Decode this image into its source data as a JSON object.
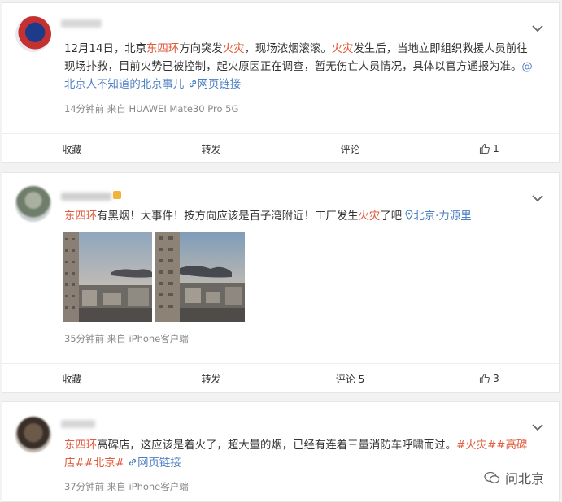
{
  "posts": [
    {
      "content": {
        "p1": "12月14日，北京",
        "k1": "东四环",
        "p2": "方向突发",
        "k2": "火灾",
        "p3": "，现场浓烟滚滚。",
        "k3": "火灾",
        "p4": "发生后，当地立即组织救援人员前往现场扑救，目前火势已被控制，起火原因正在调查，暂无伤亡人员情况，具体以官方通报为准。",
        "mention": "@北京人不知道的北京事儿",
        "weblink": "网页链接"
      },
      "meta": "14分钟前  来自 HUAWEI Mate30 Pro 5G",
      "actions": {
        "fav": "收藏",
        "repost": "转发",
        "comment": "评论",
        "like": "1"
      }
    },
    {
      "content": {
        "k1": "东四环",
        "p1": "有黑烟！大事件！按方向应该是百子湾附近！工厂发生",
        "k2": "火灾",
        "p2": "了吧",
        "location": "北京·力源里"
      },
      "meta": "35分钟前  来自 iPhone客户端",
      "actions": {
        "fav": "收藏",
        "repost": "转发",
        "comment": "评论 5",
        "like": "3"
      }
    },
    {
      "content": {
        "k1": "东四环",
        "p1": "高碑店，这应该是着火了，超大量的烟，已经有连着三量消防车呼啸而过。",
        "tags": "#火灾##高碑店##北京#",
        "weblink": "网页链接"
      },
      "meta": "37分钟前  来自 iPhone客户端"
    }
  ],
  "watermark": "问北京",
  "colors": {
    "keyword": "#e05a3c",
    "link": "#4d7fc3"
  }
}
